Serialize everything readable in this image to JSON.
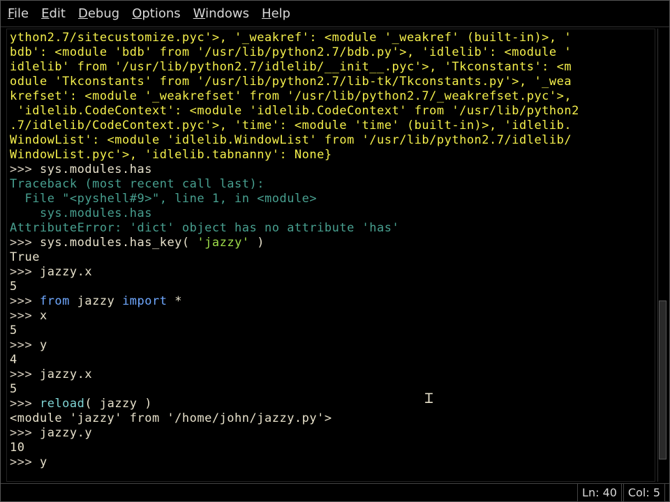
{
  "menu": {
    "file": "File",
    "edit": "Edit",
    "debug": "Debug",
    "options": "Options",
    "windows": "Windows",
    "help": "Help"
  },
  "shell": {
    "line01": "ython2.7/sitecustomize.pyc'>, '_weakref': <module '_weakref' (built-in)>, '",
    "line02": "bdb': <module 'bdb' from '/usr/lib/python2.7/bdb.py'>, 'idlelib': <module '",
    "line03": "idlelib' from '/usr/lib/python2.7/idlelib/__init__.pyc'>, 'Tkconstants': <m",
    "line04": "odule 'Tkconstants' from '/usr/lib/python2.7/lib-tk/Tkconstants.py'>, '_wea",
    "line05": "krefset': <module '_weakrefset' from '/usr/lib/python2.7/_weakrefset.pyc'>,",
    "line06": " 'idlelib.CodeContext': <module 'idlelib.CodeContext' from '/usr/lib/python2",
    "line07": ".7/idlelib/CodeContext.pyc'>, 'time': <module 'time' (built-in)>, 'idlelib.",
    "line08": "WindowList': <module 'idlelib.WindowList' from '/usr/lib/python2.7/idlelib/",
    "line09": "WindowList.pyc'>, 'idlelib.tabnanny': None}",
    "prompt": ">>> ",
    "l10_code": "sys.modules.has",
    "l11": "Traceback (most recent call last):",
    "l12": "  File \"<pyshell#9>\", line 1, in <module>",
    "l13": "    sys.modules.has",
    "l14": "AttributeError: 'dict' object has no attribute 'has'",
    "l15a": "sys.modules.has_key( ",
    "l15b": "'jazzy'",
    "l15c": " )",
    "l16": "True",
    "l17": "jazzy.x",
    "l18": "5",
    "l19_from": "from",
    "l19_mod": " jazzy ",
    "l19_import": "import",
    "l19_star": " *",
    "l20a": "x",
    "l21": "5",
    "l22a": "y",
    "l23": "4",
    "l24": "jazzy.x",
    "l25": "5",
    "l26a": "reload",
    "l26b": "( jazzy )",
    "l27": "<module 'jazzy' from '/home/john/jazzy.py'>",
    "l28": "jazzy.y",
    "l29": "10",
    "l30": "y"
  },
  "status": {
    "line_lbl": "Ln: ",
    "line_val": "40",
    "col_lbl": "Col: ",
    "col_val": "5"
  }
}
